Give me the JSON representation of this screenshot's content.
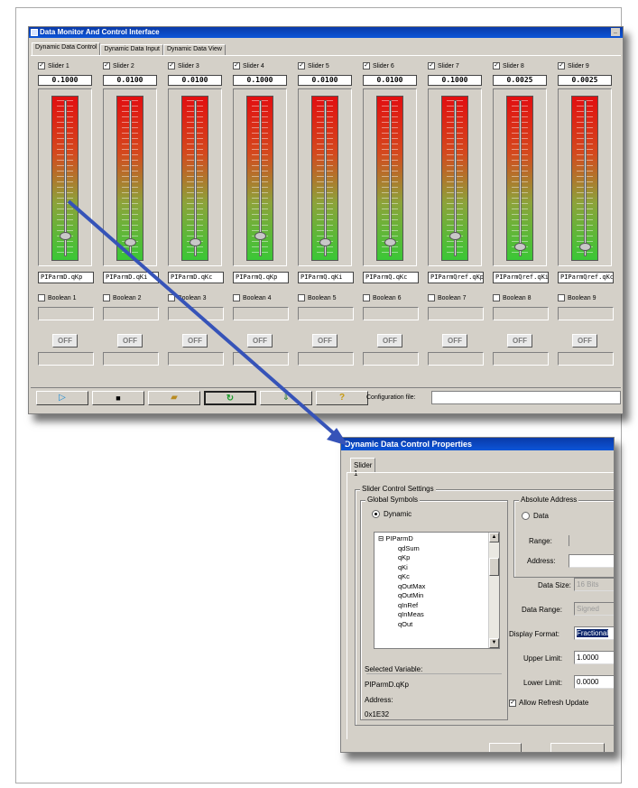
{
  "main_window": {
    "title": "Data Monitor And Control Interface",
    "tabs": [
      "Dynamic Data Control",
      "Dynamic Data Input",
      "Dynamic Data View"
    ],
    "sliders": [
      {
        "label": "Slider 1",
        "value": "0.1000",
        "variable": "PIParmD.qKp",
        "boolean": "Boolean 1",
        "button": "OFF",
        "level": 0.12
      },
      {
        "label": "Slider 2",
        "value": "0.0100",
        "variable": "PIParmD.qKi",
        "boolean": "Boolean 2",
        "button": "OFF",
        "level": 0.08
      },
      {
        "label": "Slider 3",
        "value": "0.0100",
        "variable": "PIParmD.qKc",
        "boolean": "Boolean 3",
        "button": "OFF",
        "level": 0.08
      },
      {
        "label": "Slider 4",
        "value": "0.1000",
        "variable": "PIParmQ.qKp",
        "boolean": "Boolean 4",
        "button": "OFF",
        "level": 0.12
      },
      {
        "label": "Slider 5",
        "value": "0.0100",
        "variable": "PIParmQ.qKi",
        "boolean": "Boolean 5",
        "button": "OFF",
        "level": 0.08
      },
      {
        "label": "Slider 6",
        "value": "0.0100",
        "variable": "PIParmQ.qKc",
        "boolean": "Boolean 6",
        "button": "OFF",
        "level": 0.08
      },
      {
        "label": "Slider 7",
        "value": "0.1000",
        "variable": "PIParmQref.qKp",
        "boolean": "Boolean 7",
        "button": "OFF",
        "level": 0.12
      },
      {
        "label": "Slider 8",
        "value": "0.0025",
        "variable": "PIParmQref.qKi",
        "boolean": "Boolean 8",
        "button": "OFF",
        "level": 0.05
      },
      {
        "label": "Slider 9",
        "value": "0.0025",
        "variable": "PIParmQref.qKc",
        "boolean": "Boolean 9",
        "button": "OFF",
        "level": 0.05
      }
    ],
    "toolbar": {
      "icons": [
        "play-icon",
        "save-icon",
        "open-folder-icon",
        "refresh-icon",
        "download-icon",
        "help-icon"
      ],
      "glyphs": [
        "▷",
        "■",
        "▰",
        "↻",
        "⇓",
        "?"
      ],
      "config_label": "Configuration file:",
      "config_value": ""
    }
  },
  "properties_dialog": {
    "title": "Dynamic Data Control Properties",
    "tab": "Slider 1",
    "slider_settings_label": "Slider Control Settings",
    "global_symbols_label": "Global Symbols",
    "dynamic_radio": "Dynamic",
    "tree_items": [
      "⊟ PIParmD",
      "qdSum",
      "qKp",
      "qKi",
      "qKc",
      "qOutMax",
      "qOutMin",
      "qInRef",
      "qInMeas",
      "qOut"
    ],
    "selected_variable_label": "Selected Variable:",
    "selected_variable": "PIParmD.qKp",
    "address_label": "Address:",
    "address_value": "0x1E32",
    "absolute_address_label": "Absolute Address",
    "data_radio": "Data",
    "range_label": "Range:",
    "abs_address_label": "Address:",
    "data_size_label": "Data Size:",
    "data_size_value": "16 Bits",
    "data_range_label": "Data Range:",
    "data_range_value": "Signed",
    "display_format_label": "Display Format:",
    "display_format_value": "Fractional",
    "upper_limit_label": "Upper Limit:",
    "upper_limit_value": "1.0000",
    "lower_limit_label": "Lower Limit:",
    "lower_limit_value": "0.0000",
    "allow_refresh_label": "Allow Refresh Update",
    "accent": "#3653b8"
  }
}
